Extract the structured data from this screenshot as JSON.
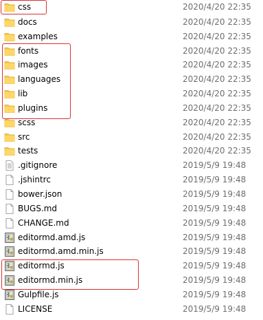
{
  "files": [
    {
      "name": "css",
      "date": "2020/4/20 22:35",
      "icon": "folder-icon"
    },
    {
      "name": "docs",
      "date": "2020/4/20 22:35",
      "icon": "folder-icon"
    },
    {
      "name": "examples",
      "date": "2020/4/20 22:35",
      "icon": "folder-icon"
    },
    {
      "name": "fonts",
      "date": "2020/4/20 22:35",
      "icon": "folder-icon"
    },
    {
      "name": "images",
      "date": "2020/4/20 22:35",
      "icon": "folder-icon"
    },
    {
      "name": "languages",
      "date": "2020/4/20 22:35",
      "icon": "folder-icon"
    },
    {
      "name": "lib",
      "date": "2020/4/20 22:35",
      "icon": "folder-icon"
    },
    {
      "name": "plugins",
      "date": "2020/4/20 22:35",
      "icon": "folder-icon"
    },
    {
      "name": "scss",
      "date": "2020/4/20 22:35",
      "icon": "folder-icon"
    },
    {
      "name": "src",
      "date": "2020/4/20 22:35",
      "icon": "folder-icon"
    },
    {
      "name": "tests",
      "date": "2020/4/20 22:35",
      "icon": "folder-icon"
    },
    {
      "name": ".gitignore",
      "date": "2019/5/9 19:48",
      "icon": "text-file-icon"
    },
    {
      "name": ".jshintrc",
      "date": "2019/5/9 19:48",
      "icon": "blank-file-icon"
    },
    {
      "name": "bower.json",
      "date": "2019/5/9 19:48",
      "icon": "blank-file-icon"
    },
    {
      "name": "BUGS.md",
      "date": "2019/5/9 19:48",
      "icon": "blank-file-icon"
    },
    {
      "name": "CHANGE.md",
      "date": "2019/5/9 19:48",
      "icon": "blank-file-icon"
    },
    {
      "name": "editormd.amd.js",
      "date": "2019/5/9 19:48",
      "icon": "script-file-icon"
    },
    {
      "name": "editormd.amd.min.js",
      "date": "2019/5/9 19:48",
      "icon": "script-file-icon"
    },
    {
      "name": "editormd.js",
      "date": "2019/5/9 19:48",
      "icon": "script-file-icon"
    },
    {
      "name": "editormd.min.js",
      "date": "2019/5/9 19:48",
      "icon": "script-file-icon"
    },
    {
      "name": "Gulpfile.js",
      "date": "2019/5/9 19:48",
      "icon": "script-file-icon"
    },
    {
      "name": "LICENSE",
      "date": "2019/5/9 19:48",
      "icon": "blank-file-icon"
    }
  ],
  "colors": {
    "highlight": "#d9302f",
    "date": "#6d6d6d",
    "folder": "#f5c84c"
  }
}
